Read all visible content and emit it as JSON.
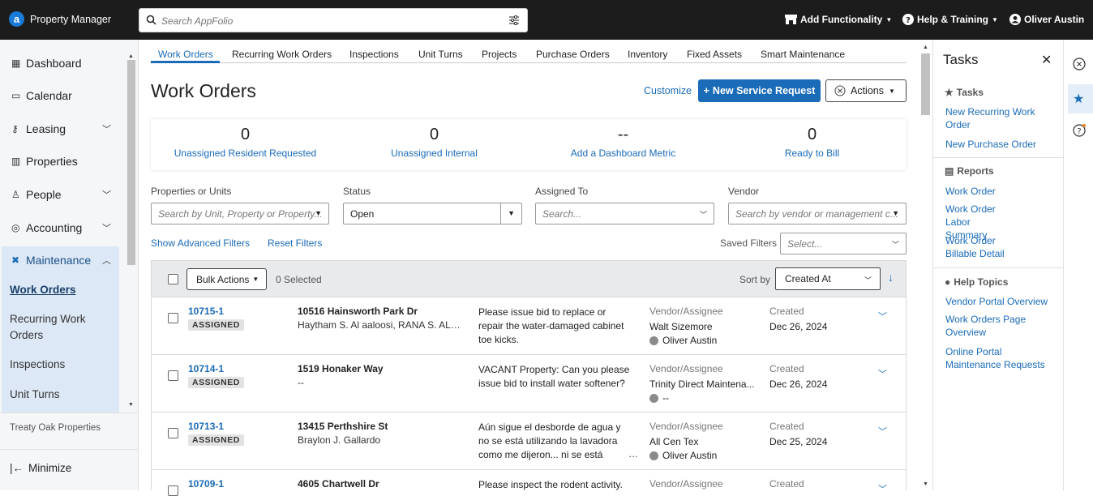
{
  "topbar": {
    "logo_letter": "a",
    "brand": "Property Manager",
    "search_placeholder": "Search AppFolio",
    "add_functionality": "Add Functionality",
    "help": "Help & Training",
    "user": "Oliver Austin"
  },
  "sidebar": {
    "items": [
      {
        "label": "Dashboard",
        "icon": "dashboard-icon"
      },
      {
        "label": "Calendar",
        "icon": "calendar-icon"
      },
      {
        "label": "Leasing",
        "icon": "key-icon"
      },
      {
        "label": "Properties",
        "icon": "building-icon"
      },
      {
        "label": "People",
        "icon": "person-icon"
      },
      {
        "label": "Accounting",
        "icon": "accounting-icon"
      },
      {
        "label": "Maintenance",
        "icon": "tools-icon"
      }
    ],
    "maintenance_sub": [
      "Work Orders",
      "Recurring Work",
      "Orders",
      "Inspections",
      "Unit Turns"
    ],
    "company": "Treaty Oak Properties",
    "minimize": "Minimize"
  },
  "tabs": [
    "Work Orders",
    "Recurring Work Orders",
    "Inspections",
    "Unit Turns",
    "Projects",
    "Purchase Orders",
    "Inventory",
    "Fixed Assets",
    "Smart Maintenance"
  ],
  "page": {
    "title": "Work Orders",
    "customize": "Customize",
    "new_request": "New Service Request",
    "actions": "Actions"
  },
  "metrics": [
    {
      "value": "0",
      "label": "Unassigned Resident Requested"
    },
    {
      "value": "0",
      "label": "Unassigned Internal"
    },
    {
      "value": "--",
      "label": "Add a Dashboard Metric"
    },
    {
      "value": "0",
      "label": "Ready to Bill"
    }
  ],
  "filters": {
    "properties_label": "Properties or Units",
    "properties_placeholder": "Search by Unit, Property or Property...",
    "status_label": "Status",
    "status_value": "Open",
    "assigned_label": "Assigned To",
    "assigned_placeholder": "Search...",
    "vendor_label": "Vendor",
    "vendor_placeholder": "Search by vendor or management c...",
    "advanced": "Show Advanced Filters",
    "reset": "Reset Filters",
    "saved_label": "Saved Filters",
    "saved_placeholder": "Select..."
  },
  "list": {
    "bulk_actions": "Bulk Actions",
    "selected": "0 Selected",
    "sort_by": "Sort by",
    "sort_value": "Created At"
  },
  "rows": [
    {
      "id": "10715-1",
      "status": "ASSIGNED",
      "address": "10516 Hainsworth Park Dr",
      "tenant": "Haytham S. Al aaloosi, RANA S. ALS...",
      "desc": "Please issue bid to replace or repair the water-damaged cabinet toe kicks.",
      "vendor_label": "Vendor/Assignee",
      "vendor": "Walt Sizemore",
      "assignee": "Oliver Austin",
      "created_label": "Created",
      "created": "Dec 26, 2024",
      "truncated": false
    },
    {
      "id": "10714-1",
      "status": "ASSIGNED",
      "address": "1519 Honaker Way",
      "tenant": "--",
      "desc": "VACANT Property: Can you please issue bid to install water softener?",
      "vendor_label": "Vendor/Assignee",
      "vendor": "Trinity Direct Maintena...",
      "assignee": "--",
      "created_label": "Created",
      "created": "Dec 26, 2024",
      "truncated": false
    },
    {
      "id": "10713-1",
      "status": "ASSIGNED",
      "address": "13415 Perthshire St",
      "tenant": "Braylon J. Gallardo",
      "desc": "Aún sigue el desborde de agua y no se está utilizando la lavadora como me dijeron... ni se está",
      "vendor_label": "Vendor/Assignee",
      "vendor": "All Cen Tex",
      "assignee": "Oliver Austin",
      "created_label": "Created",
      "created": "Dec 25, 2024",
      "truncated": true
    },
    {
      "id": "10709-1",
      "status": "",
      "address": "4605 Chartwell Dr",
      "tenant": "",
      "desc": "Please inspect the rodent activity.",
      "vendor_label": "Vendor/Assignee",
      "vendor": "",
      "assignee": "",
      "created_label": "Created",
      "created": "",
      "truncated": false
    }
  ],
  "tasks": {
    "title": "Tasks",
    "sections": [
      {
        "title": "Tasks",
        "icon": "star-icon",
        "links": [
          "New Recurring Work Order",
          "New Purchase Order"
        ]
      },
      {
        "title": "Reports",
        "icon": "report-icon",
        "links": [
          "Work Order",
          "Work Order Labor Summary",
          "Work Order Billable Detail"
        ]
      },
      {
        "title": "Help Topics",
        "icon": "help-icon",
        "links": [
          "Vendor Portal Overview",
          "Work Orders Page Overview",
          "Online Portal Maintenance Requests"
        ]
      }
    ]
  },
  "colors": {
    "accent": "#1a6bb8",
    "topbar": "#1c1c1c",
    "sidebar_active": "#dce8f5"
  }
}
